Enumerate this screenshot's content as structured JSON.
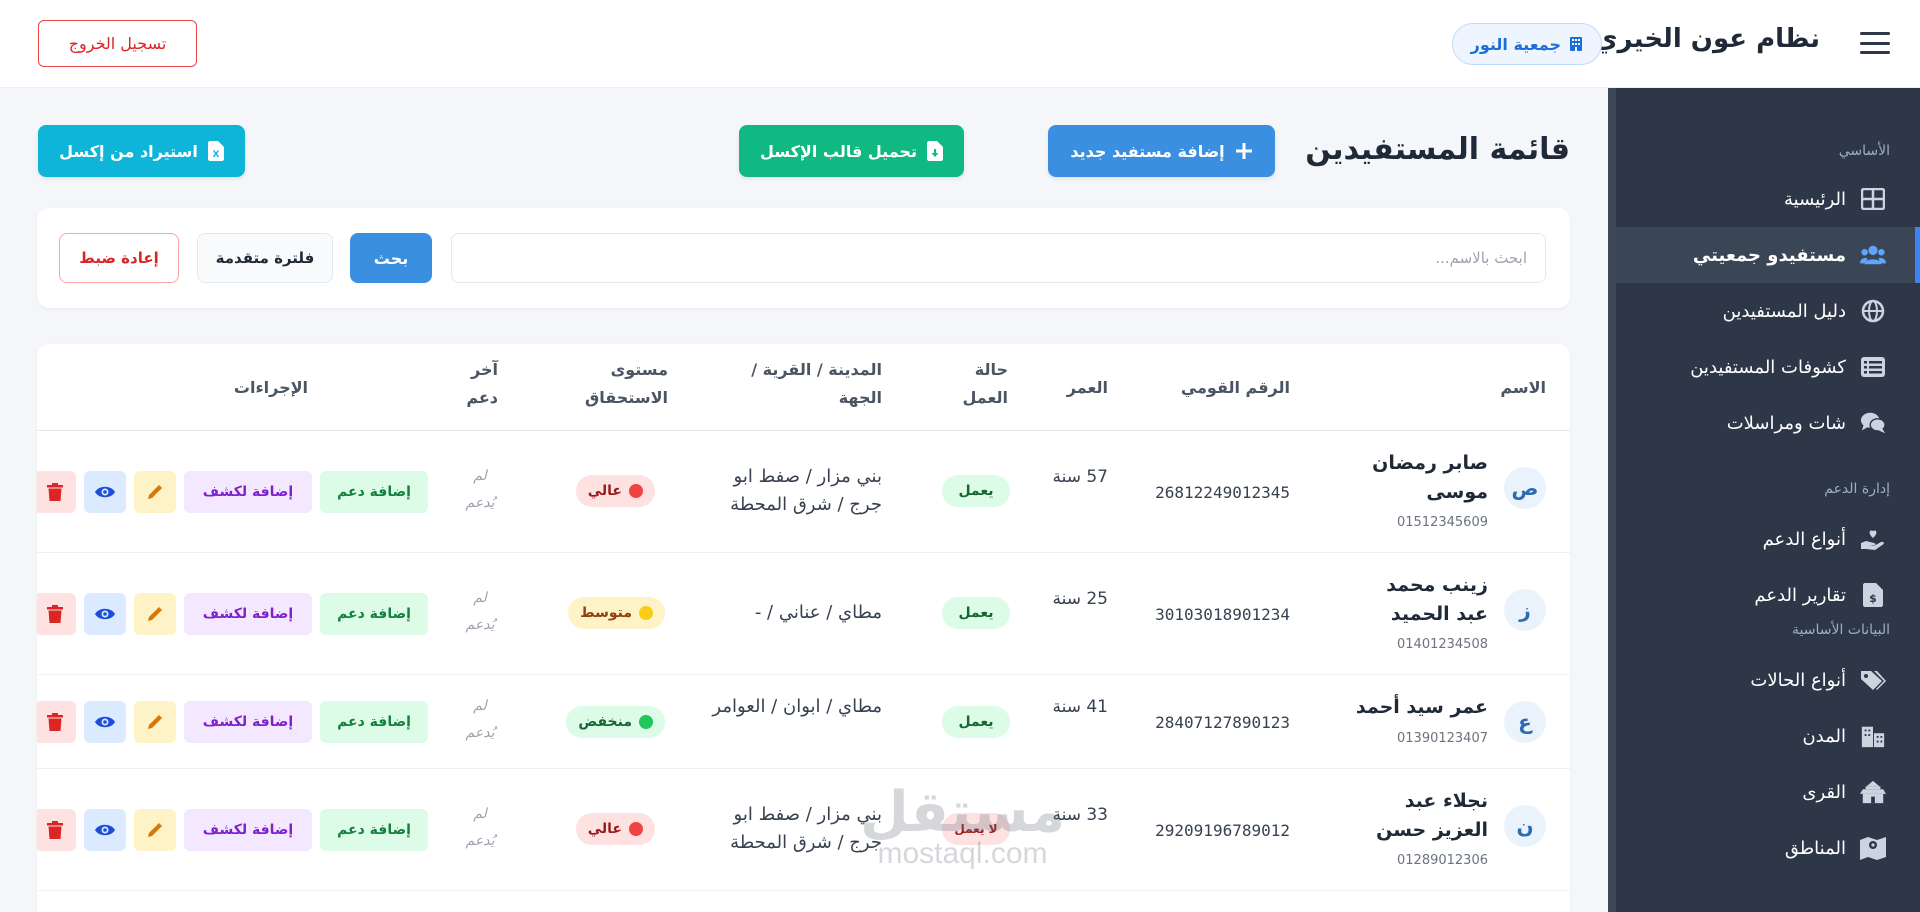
{
  "header": {
    "app_title": "نظام عون الخيري",
    "org_name": "جمعية النور",
    "logout_label": "تسجيل الخروج"
  },
  "sidebar": {
    "sections": [
      {
        "title": "الأساسي",
        "items": [
          {
            "label": "الرئيسية",
            "icon": "dashboard-icon"
          },
          {
            "label": "مستفيدو جمعيتي",
            "icon": "users-icon",
            "active": true
          },
          {
            "label": "دليل المستفيدين",
            "icon": "globe-icon"
          },
          {
            "label": "كشوفات المستفيدين",
            "icon": "list-icon"
          },
          {
            "label": "شات ومراسلات",
            "icon": "chat-icon"
          }
        ]
      },
      {
        "title": "إدارة الدعم",
        "items": [
          {
            "label": "أنواع الدعم",
            "icon": "hand-heart-icon"
          },
          {
            "label": "تقارير الدعم",
            "icon": "report-icon"
          }
        ]
      },
      {
        "title": "البيانات الأساسية",
        "items": [
          {
            "label": "أنواع الحالات",
            "icon": "tags-icon"
          },
          {
            "label": "المدن",
            "icon": "city-icon"
          },
          {
            "label": "القرى",
            "icon": "village-icon"
          },
          {
            "label": "المناطق",
            "icon": "map-icon"
          }
        ]
      }
    ]
  },
  "main": {
    "page_title": "قائمة المستفيدين",
    "add_beneficiary_label": "إضافة مستفيد جديد",
    "download_template_label": "تحميل قالب الإكسل",
    "import_excel_label": "استيراد من إكسل",
    "search_placeholder": "ابحث بالاسم...",
    "search_label": "بحث",
    "advanced_filter_label": "فلترة متقدمة",
    "reset_label": "إعادة ضبط"
  },
  "table": {
    "headers": {
      "name": "الاسم",
      "national_id": "الرقم القومي",
      "age": "العمر",
      "work_status_1": "حالة",
      "work_status_2": "العمل",
      "location_1": "المدينة / القرية /",
      "location_2": "الجهة",
      "eligibility_1": "مستوى",
      "eligibility_2": "الاستحقاق",
      "last_support_1": "آخر",
      "last_support_2": "دعم",
      "actions": "الإجراءات"
    },
    "action_labels": {
      "add_support": "إضافة دعم",
      "add_to_sheet": "إضافة لكشف"
    },
    "rows": [
      {
        "initial": "ص",
        "name": "صابر رمضان موسى",
        "phone": "01512345609",
        "national_id": "26812249012345",
        "age": "57 سنة",
        "work": "يعمل",
        "location": "بني مزار / صفط ابو جرج / شرق المحطة",
        "level": "عالي",
        "level_key": "high",
        "last_support": "لم يُدعم"
      },
      {
        "initial": "ز",
        "name": "زينب محمد عبد الحميد",
        "phone": "01401234508",
        "national_id": "30103018901234",
        "age": "25 سنة",
        "work": "يعمل",
        "location": "مطاي / عناني / -",
        "level": "متوسط",
        "level_key": "mid",
        "last_support": "لم يُدعم"
      },
      {
        "initial": "ع",
        "name": "عمر سيد أحمد",
        "phone": "01390123407",
        "national_id": "28407127890123",
        "age": "41 سنة",
        "work": "يعمل",
        "location": "مطاي / ابوان / العوامر",
        "level": "منخفض",
        "level_key": "low",
        "last_support": "لم يُدعم"
      },
      {
        "initial": "ن",
        "name": "نجلاء عبد العزيز حسن",
        "phone": "01289012306",
        "national_id": "29209196789012",
        "age": "33 سنة",
        "work": "لا يعمل",
        "location": "بني مزار / صفط ابو جرج / شرق المحطة",
        "level": "عالي",
        "level_key": "high",
        "last_support": "لم يُدعم"
      }
    ]
  },
  "watermark": {
    "arabic": "مستقل",
    "latin": "mostaql.com"
  },
  "colors": {
    "sidebar_bg": "#2d3748",
    "primary": "#3b8fe0",
    "success": "#10b981",
    "info": "#0fb5d8",
    "danger": "#dc2626"
  }
}
